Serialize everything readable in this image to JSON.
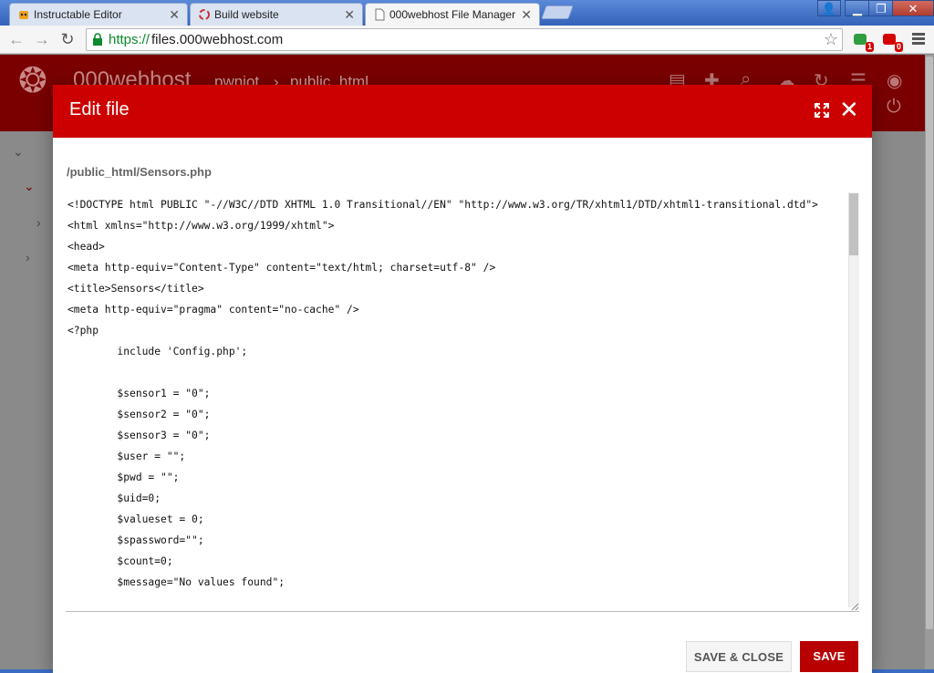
{
  "browser": {
    "tabs": [
      {
        "title": "Instructable Editor",
        "icon": "robot-icon",
        "active": false
      },
      {
        "title": "Build website",
        "icon": "swirl-icon",
        "active": false
      },
      {
        "title": "000webhost File Manager",
        "icon": "page-icon",
        "active": true
      }
    ],
    "url_scheme": "https://",
    "url_host": "files.000webhost.com",
    "extensions": [
      {
        "icon": "puzzle-icon",
        "badge": "1",
        "color": "#2e9e3e"
      },
      {
        "icon": "shield-icon",
        "badge": "0",
        "color": "#d40000"
      }
    ]
  },
  "app": {
    "brand": "000webhost",
    "breadcrumb": [
      "pwniot",
      "public_html"
    ],
    "header_icons": [
      "new-file-icon",
      "plus-icon",
      "search-icon",
      "upload-icon",
      "refresh-icon",
      "list-icon",
      "globe-icon",
      "power-icon"
    ]
  },
  "modal": {
    "title": "Edit file",
    "file_path": "/public_html/Sensors.php",
    "code_lines": [
      "<!DOCTYPE html PUBLIC \"-//W3C//DTD XHTML 1.0 Transitional//EN\" \"http://www.w3.org/TR/xhtml1/DTD/xhtml1-transitional.dtd\">",
      "<html xmlns=\"http://www.w3.org/1999/xhtml\">",
      "<head>",
      "<meta http-equiv=\"Content-Type\" content=\"text/html; charset=utf-8\" />",
      "<title>Sensors</title>",
      "<meta http-equiv=\"pragma\" content=\"no-cache\" />",
      "<?php",
      "        include 'Config.php';",
      "",
      "        $sensor1 = \"0\";",
      "        $sensor2 = \"0\";",
      "        $sensor3 = \"0\";",
      "        $user = \"\";",
      "        $pwd = \"\";",
      "        $uid=0;",
      "        $valueset = 0;",
      "        $spassword=\"\";",
      "        $count=0;",
      "        $message=\"No values found\";"
    ],
    "save_close_label": "SAVE & CLOSE",
    "save_label": "SAVE"
  },
  "colors": {
    "modal_header": "#cc0000",
    "save_button": "#b80000",
    "app_header": "#7a0000"
  }
}
